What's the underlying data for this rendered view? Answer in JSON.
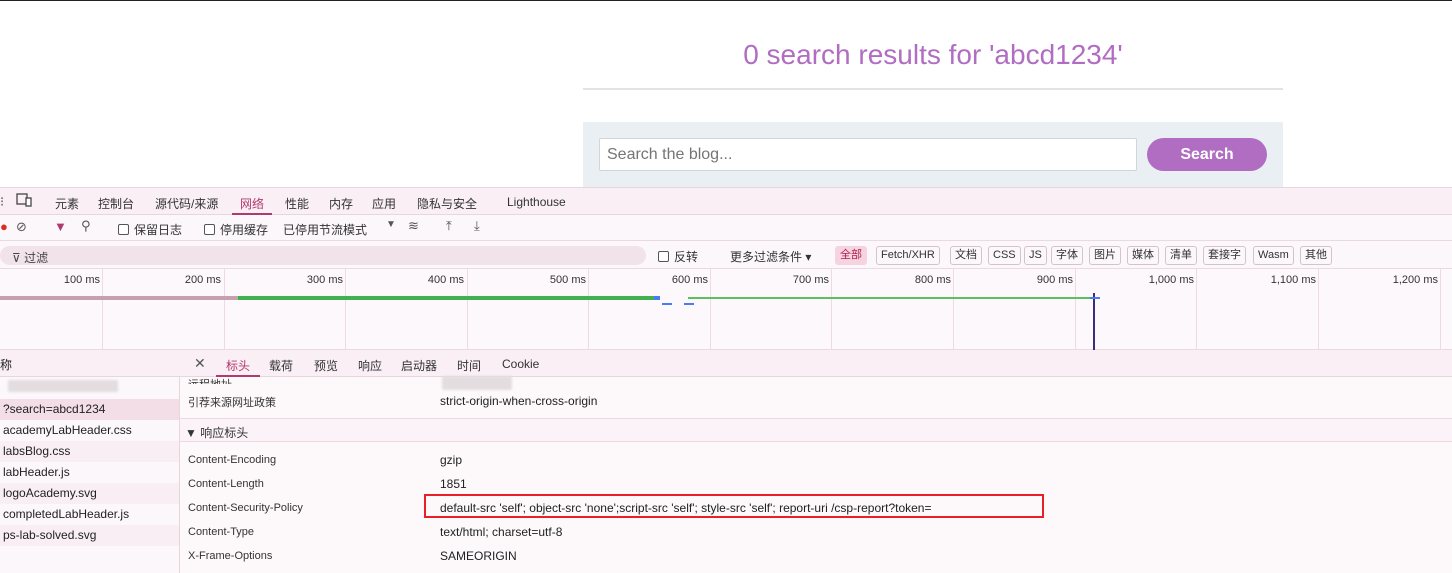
{
  "page": {
    "results_title": "0 search results for 'abcd1234'",
    "search_placeholder": "Search the blog...",
    "search_button": "Search"
  },
  "devtools": {
    "tabs": [
      {
        "label": "元素"
      },
      {
        "label": "控制台"
      },
      {
        "label": "源代码/来源"
      },
      {
        "label": "网络"
      },
      {
        "label": "性能"
      },
      {
        "label": "内存"
      },
      {
        "label": "应用"
      },
      {
        "label": "隐私与安全"
      },
      {
        "label": "Lighthouse"
      }
    ],
    "toolbar": {
      "preserve_log": "保留日志",
      "disable_cache": "停用缓存",
      "throttle": "已停用节流模式"
    },
    "filter": {
      "placeholder": "过滤",
      "invert": "反转",
      "more_filters": "更多过滤条件",
      "types": [
        "全部",
        "Fetch/XHR",
        "文档",
        "CSS",
        "JS",
        "字体",
        "图片",
        "媒体",
        "清单",
        "套接字",
        "Wasm",
        "其他"
      ]
    },
    "timeline_ticks": [
      "100 ms",
      "200 ms",
      "300 ms",
      "400 ms",
      "500 ms",
      "600 ms",
      "700 ms",
      "800 ms",
      "900 ms",
      "1,000 ms",
      "1,100 ms",
      "1,200 ms"
    ],
    "request_list": {
      "header": "称",
      "items": [
        "?search=abcd1234",
        "academyLabHeader.css",
        "labsBlog.css",
        "labHeader.js",
        "logoAcademy.svg",
        "completedLabHeader.js",
        "ps-lab-solved.svg"
      ]
    },
    "detail_tabs": [
      "标头",
      "载荷",
      "预览",
      "响应",
      "启动器",
      "时间",
      "Cookie"
    ],
    "general": {
      "remote_address_label": "远程地址",
      "referrer_policy_label": "引荐来源网址政策",
      "referrer_policy_value": "strict-origin-when-cross-origin"
    },
    "response_headers_title": "▼ 响应标头",
    "response_headers": [
      {
        "name": "Content-Encoding",
        "value": "gzip"
      },
      {
        "name": "Content-Length",
        "value": "1851"
      },
      {
        "name": "Content-Security-Policy",
        "value": "default-src 'self'; object-src 'none';script-src 'self'; style-src 'self'; report-uri /csp-report?token="
      },
      {
        "name": "Content-Type",
        "value": "text/html; charset=utf-8"
      },
      {
        "name": "X-Frame-Options",
        "value": "SAMEORIGIN"
      }
    ],
    "colors": {
      "accent": "#b03a6f",
      "brand": "#b06dc2",
      "highlight_box": "#e8202a"
    }
  }
}
